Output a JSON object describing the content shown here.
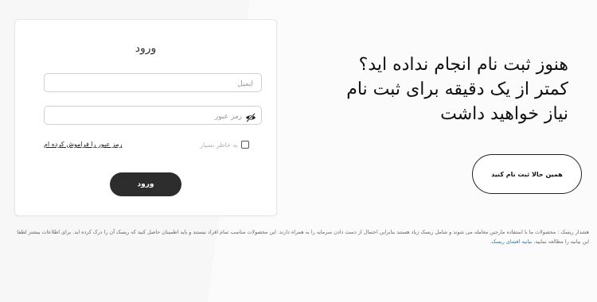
{
  "login": {
    "title": "ورود",
    "email_placeholder": "ایمیل",
    "password_placeholder": "رمز عبور",
    "remember_label": "به خاطر بسپار",
    "forgot_label": "رمز عبور را فراموش کرده ام",
    "submit_label": "ورود"
  },
  "promo": {
    "line1": "هنوز ثبت نام انجام نداده اید؟",
    "line2": "کمتر از یک دقیقه برای ثبت نام",
    "line3": "نیاز خواهید داشت",
    "signup_label": "همین حالا ثبت نام کنید"
  },
  "risk": {
    "text": "هشدار ریسک : محصولات ما با استفاده مارجین معامله می شوند و شامل ریسک زیاد هستند بنابراین احتمال از دست دادن سرمایه را به همراه دارند. این محصولات مناسب تمام افراد نیستند و باید اطمینان حاصل کنید که ریسک آن را درک کرده اید. برای اطلاعات بیشتر لطفا این بیانیه را مطالعه نمایید.",
    "link_label": "بیانیه افشای ریسک."
  },
  "colors": {
    "button_dark": "#2d2d2d",
    "link": "#2e7d9a"
  }
}
